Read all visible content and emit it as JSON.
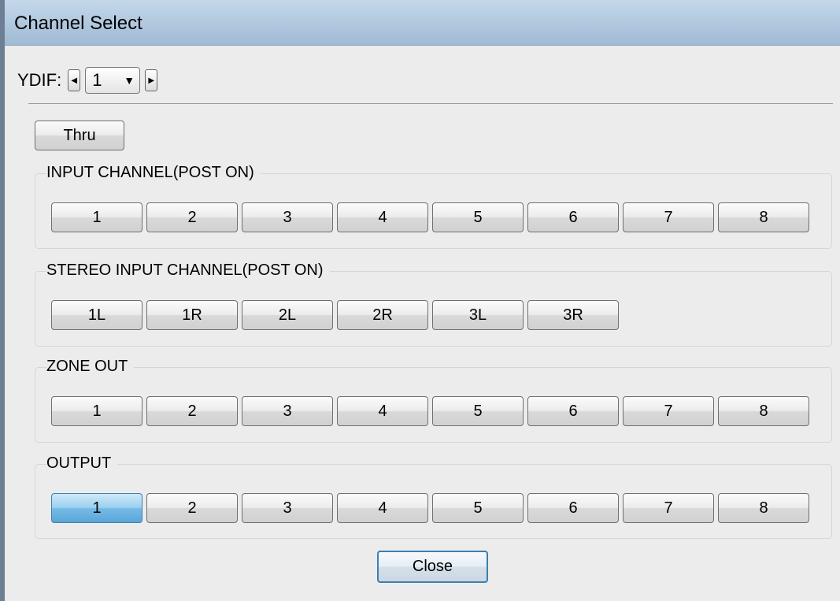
{
  "window": {
    "title": "Channel Select"
  },
  "ydif": {
    "label": "YDIF:",
    "value": "1"
  },
  "thru_label": "Thru",
  "groups": [
    {
      "title": "INPUT CHANNEL(POST ON)",
      "buttons": [
        "1",
        "2",
        "3",
        "4",
        "5",
        "6",
        "7",
        "8"
      ]
    },
    {
      "title": "STEREO INPUT CHANNEL(POST ON)",
      "buttons": [
        "1L",
        "1R",
        "2L",
        "2R",
        "3L",
        "3R"
      ]
    },
    {
      "title": "ZONE OUT",
      "buttons": [
        "1",
        "2",
        "3",
        "4",
        "5",
        "6",
        "7",
        "8"
      ]
    },
    {
      "title": "OUTPUT",
      "buttons": [
        "1",
        "2",
        "3",
        "4",
        "5",
        "6",
        "7",
        "8"
      ],
      "selected": "1"
    }
  ],
  "close_label": "Close",
  "colors": {
    "selected_button": "#76bbe6",
    "title_bar": "#b3cbe2"
  }
}
